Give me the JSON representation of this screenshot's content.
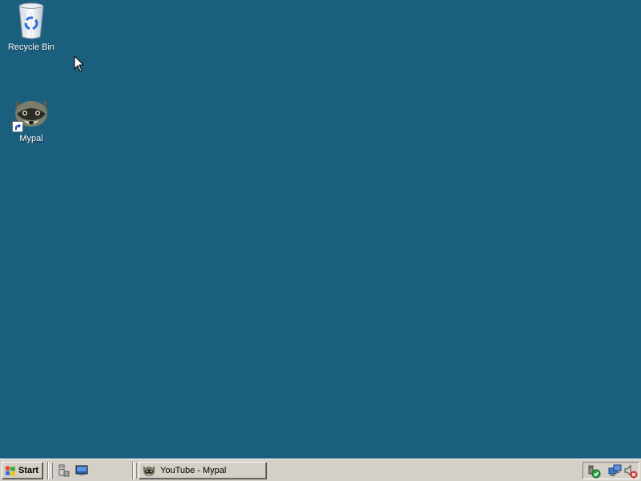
{
  "desktop": {
    "background_color": "#1b5f7f",
    "icons": [
      {
        "label": "Recycle Bin",
        "icon": "recycle-bin-icon"
      },
      {
        "label": "Mypal",
        "icon": "raccoon-icon"
      }
    ]
  },
  "taskbar": {
    "start_label": "Start",
    "quick_launch": [
      {
        "icon": "server-manager-icon"
      },
      {
        "icon": "show-desktop-icon"
      }
    ],
    "tasks": [
      {
        "label": "YouTube - Mypal",
        "icon": "raccoon-icon"
      }
    ],
    "tray": [
      {
        "icon": "security-shield-icon"
      },
      {
        "icon": "network-icon"
      },
      {
        "icon": "volume-muted-icon"
      }
    ]
  }
}
